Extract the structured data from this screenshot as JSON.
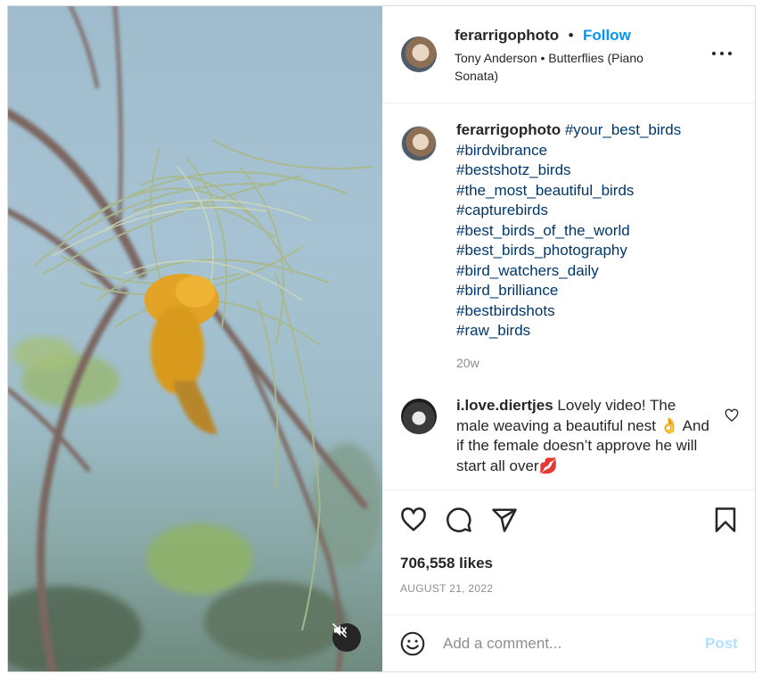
{
  "post": {
    "username": "ferarrigophoto",
    "follow_label": "Follow",
    "separator": "•",
    "audio": "Tony Anderson • Butterflies (Piano Sonata)",
    "more_icon": "more-horizontal-icon"
  },
  "caption": {
    "username": "ferarrigophoto",
    "hashtags": [
      "#your_best_birds",
      "#birdvibrance",
      "#bestshotz_birds",
      "#the_most_beautiful_birds",
      "#capturebirds",
      "#best_birds_of_the_world",
      "#best_birds_photography",
      "#bird_watchers_daily",
      "#bird_brilliance",
      "#bestbirdshots",
      "#raw_birds"
    ],
    "time": "20w"
  },
  "comment": {
    "username": "i.love.diertjes",
    "text": "Lovely video! The male weaving a beautiful nest 👌 And if the female doesn’t approve he will start all over💋"
  },
  "stats": {
    "likes": "706,558 likes",
    "date": "AUGUST 21, 2022"
  },
  "add_comment": {
    "placeholder": "Add a comment...",
    "post_label": "Post"
  },
  "colors": {
    "accent": "#0095f6",
    "hashtag": "#00376b",
    "muted": "#8e8e8e",
    "post_disabled": "#b2dffc"
  },
  "icons": [
    "heart-icon",
    "comment-icon",
    "share-icon",
    "bookmark-icon",
    "emoji-icon",
    "muted-speaker-icon",
    "small-heart-icon"
  ]
}
